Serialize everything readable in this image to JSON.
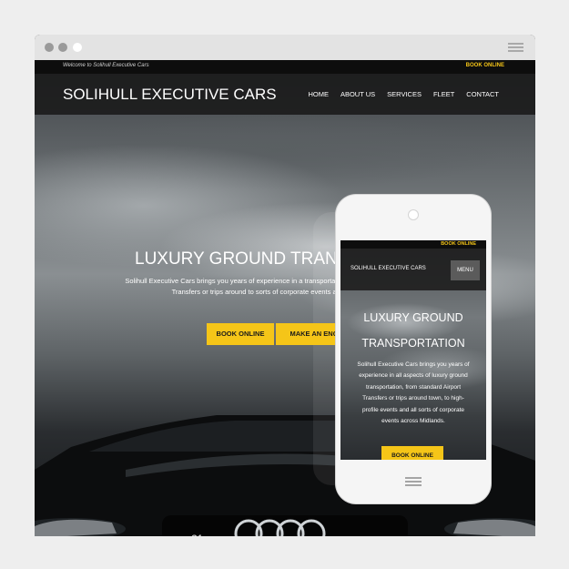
{
  "topbar": {
    "welcome": "Welcome to Solihull Executive Cars",
    "book_online": "BOOK ONLINE"
  },
  "header": {
    "logo": "SOLIHULL EXECUTIVE CARS",
    "nav": [
      "HOME",
      "ABOUT US",
      "SERVICES",
      "FLEET",
      "CONTACT"
    ]
  },
  "hero": {
    "title": "LUXURY GROUND TRANS",
    "text": "Solihull Executive Cars brings you years of experience in a transportation, from standard Airport Transfers or trips around to sorts of corporate events across Midl",
    "book_button": "BOOK ONLINE",
    "enquiry_button": "MAKE AN ENQ",
    "car_badge": "S4"
  },
  "mobile": {
    "book_online": "BOOK ONLINE",
    "logo": "SOLIHULL EXECUTIVE CARS",
    "menu_button": "MENU",
    "title": "LUXURY GROUND TRANSPORTATION",
    "text": "Solihull Executive Cars brings you years of experience in all aspects of luxury ground transportation, from standard Airport Transfers or trips around town, to high-profile events and all sorts of corporate events across Midlands.",
    "book_button": "BOOK ONLINE"
  },
  "colors": {
    "accent": "#f5c518",
    "header_bg": "#191919",
    "frame_bg": "#eeeeee"
  },
  "icons": {
    "browser_menu": "hamburger-icon",
    "phone_home": "hamburger-icon"
  }
}
